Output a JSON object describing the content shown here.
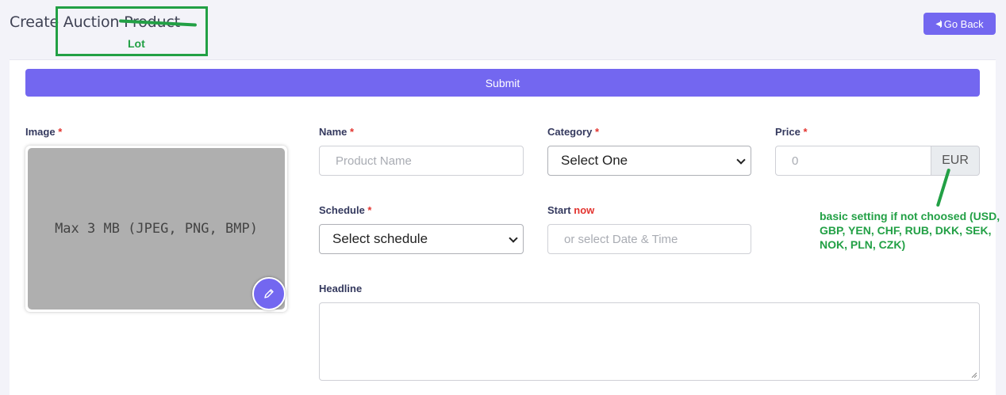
{
  "header": {
    "title": "Create Auction Product",
    "go_back_label": "Go Back"
  },
  "annotations": {
    "replacement_word": "Lot",
    "currency_note": "basic setting if not choosed (USD, GBP, YEN, CHF, RUB, DKK, SEK, NOK, PLN, CZK)",
    "color": "#22a045"
  },
  "form": {
    "submit_label": "Submit",
    "required_mark": "*",
    "image": {
      "label": "Image",
      "hint": "Max 3 MB (JPEG, PNG, BMP)"
    },
    "name": {
      "label": "Name",
      "placeholder": "Product Name"
    },
    "category": {
      "label": "Category",
      "selected": "Select One"
    },
    "price": {
      "label": "Price",
      "placeholder": "0",
      "currency": "EUR"
    },
    "schedule": {
      "label": "Schedule",
      "selected": "Select schedule"
    },
    "start": {
      "label": "Start",
      "now_label": "now",
      "placeholder": "or select Date & Time"
    },
    "headline": {
      "label": "Headline"
    }
  },
  "colors": {
    "accent": "#7367f0",
    "required": "#e3342f"
  }
}
